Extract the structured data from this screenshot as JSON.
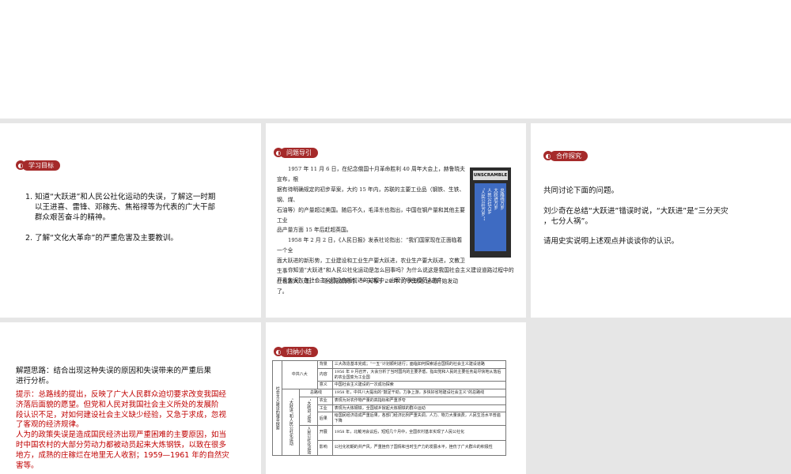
{
  "slide1": {
    "tag_label": "学习目标",
    "goal1_line1": "1. 知道“大跃进”和人民公社化运动的失误，了解这一时期",
    "goal1_line2": "以王进喜、雷锋、邓稼先、焦裕禄等为代表的广大干部",
    "goal1_line3": "群众艰苦奋斗的精神。",
    "goal2": "2. 了解“文化大革命”的严重危害及主要教训。"
  },
  "slide2": {
    "tag_label": "问题导引",
    "p1": [
      "1957 年 11 月 6 日，在纪念俄国十月革命胜利 40 周年大会上，赫鲁晓夫宣布，根",
      "据有待明确规定的初步草案，大约 15 年内，苏联的主要工业品（钢铁、生铁、钢、煤、",
      "石油等）的产量超过美国。随后不久，毛泽东也指出，中国在钢产量和其他主要工业",
      "品产量方面 15 年后赶超英国。"
    ],
    "p2": [
      "1958 年 2 月 2 日，《人民日报》发表社论指出：“我们国家现在正面临着一个全",
      "面大跃进的新形势，工业建设和工业生产要大跃进，农业生产要大跃进，文教卫生事",
      "业也要大跃进。”“一场史无前例的、‘一天等于 20 年’的‘大跃进’运动开始发动了。"
    ],
    "p3": [
      "你知道“大跃进”和人民公社化运动是怎么回事吗？为什么说这是我国社会主义建设道路过程中的",
      "严重失误？在社会主义建设曲折前进的过程中，出现了哪些模范人物？"
    ],
    "poster_word": "UNSCRAMBLE",
    "poster_cols": [
      "总路线万岁",
      "大跃进万岁",
      "人民公社万岁",
      "“人民公社万岁””"
    ]
  },
  "slide3": {
    "tag_label": "合作探究",
    "intro": "共同讨论下面的问题。",
    "quote_line1": "刘少奇在总结“大跃进”错误时说，“大跃进”是“三分天灾",
    "quote_line2": "，七分人祸”。",
    "question": "请用史实说明上述观点并谈谈你的认识。"
  },
  "slide4": {
    "idea_line1": "解题思路：结合出现这种失误的原因和失误带来的严重后果",
    "idea_line2": "进行分析。",
    "hint_lines": [
      "提示：总路线的提出，反映了广大人民群众迫切要求改变我国经",
      "济落后面貌的愿望。但党和人民对我国社会主义所处的发展阶",
      "段认识不足，对如何建设社会主义缺少经验，又急于求成，忽视",
      "了客观的经济规律。",
      "人为的政策失误是造成国民经济出现严重困难的主要原因，如当",
      "时中国农村的大部分劳动力都被动员起来大炼钢铁，以致在很多",
      "地方，成熟的庄稼烂在地里无人收割；1959—1961 年的自然灾",
      "害等。"
    ]
  },
  "slide5": {
    "tag_label": "归纳小结",
    "table": {
      "outer_label": "社会主义建设的艰辛探索",
      "bayi": "中共八大",
      "bayi_rows": [
        {
          "k": "背景",
          "v": "三大改造基本完成；“一五”计划顺利进行；面临如何探索适合国情的社会主义建设道路"
        },
        {
          "k": "内容",
          "v": "1956 年 9 月召开，大会分析了当时国内的主要矛盾，指出党和人民的主要任务是尽快地从落后的农业国变为工业国"
        },
        {
          "k": "意义",
          "v": "中国社会主义建设的一次成功探索"
        }
      ],
      "zlx_k": "总路线",
      "zlx_v": "1958 年，中共八大提出的“鼓足干劲，力争上游，多快好省地建设社会主义”的总路线",
      "dyj_group": "“大跃进”和人民公社化运动",
      "dyj_label": "“大跃进”运动",
      "dyj_rows": [
        {
          "k": "农业",
          "v": "表现为对农作物产量的高指标和严重浮夸"
        },
        {
          "k": "工业",
          "v": "表现为大炼钢铁，全国城乡掀起大炼钢铁的群众运动"
        },
        {
          "k": "后果",
          "v": "给国民经济造成严重后果，各部门经济比例严重失调，人力、物力大量浪费，人民生活水平普遍下降"
        }
      ],
      "rmgs_label": "人民公社化运动",
      "rmgs_rows": [
        {
          "k": "开展",
          "v": "1958 年，北戴河会议后，短短几个月中，全国农村基本实现了人民公社化"
        },
        {
          "k": "影响",
          "v": "公社化初期的共产风，严重挫伤了国情和当时生产力的发展水平，挫伤了广大群众的积极性"
        }
      ]
    }
  }
}
